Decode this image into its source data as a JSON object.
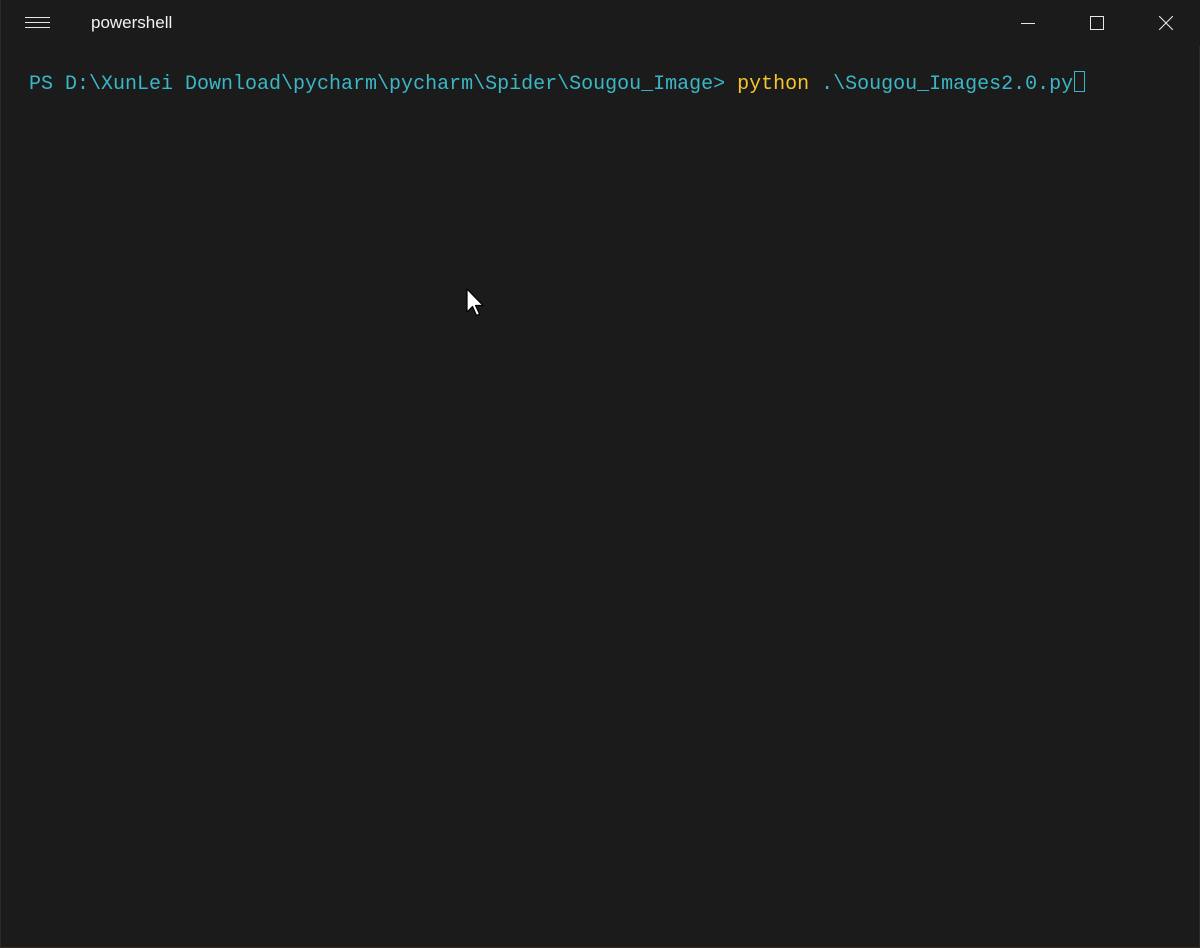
{
  "window": {
    "title": "powershell"
  },
  "titlebar": {
    "menu_icon": "hamburger-menu-icon",
    "minimize_icon": "minimize-icon",
    "maximize_icon": "maximize-icon",
    "close_icon": "close-icon"
  },
  "terminal": {
    "prompt": "PS D:\\XunLei Download\\pycharm\\pycharm\\Spider\\Sougou_Image> ",
    "command": "python",
    "argument": " .\\Sougou_Images2.0.py",
    "colors": {
      "background": "#1b1b1b",
      "prompt": "#3ab7c6",
      "command": "#f5c52a"
    }
  }
}
